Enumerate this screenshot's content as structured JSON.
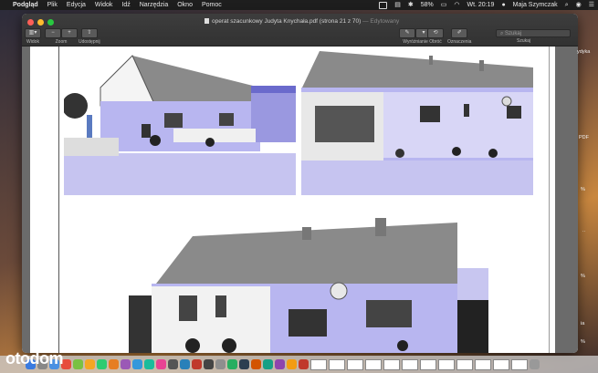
{
  "menubar": {
    "app": "Podgląd",
    "items": [
      "Plik",
      "Edycja",
      "Widok",
      "Idź",
      "Narzędzia",
      "Okno",
      "Pomoc"
    ],
    "battery": "58%",
    "clock": "Wt. 20:19",
    "user": "Maja Szymczak"
  },
  "window": {
    "title": "operat szacunkowy Judyta Knychała.pdf (strona 21 z 70)",
    "edited": "— Edytowany",
    "toolbar": {
      "view_label": "Widok",
      "zoom_label": "Zoom",
      "share_label": "Udostępnij",
      "highlight_label": "Wyróżnianie",
      "rotate_label": "Obróć",
      "markup_label": "Oznaczenia",
      "search_label": "Szukaj",
      "search_placeholder": "Szukaj"
    }
  },
  "desktop": {
    "labels": [
      "ydyka",
      "PDF",
      "%",
      "..",
      "%",
      "ia",
      "%"
    ]
  },
  "watermark": "otodom",
  "colors": {
    "wall": "#b8b6f0",
    "roof": "#8a8a8a"
  }
}
